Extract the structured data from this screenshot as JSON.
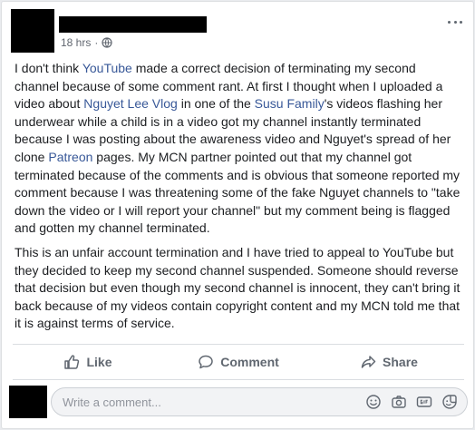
{
  "post": {
    "timestamp": "18 hrs",
    "separator": "·",
    "paragraph1": [
      {
        "text": "I don't think "
      },
      {
        "text": "YouTube",
        "link": true
      },
      {
        "text": " made a correct decision of terminating my second channel because of some comment rant. At first I thought when I uploaded a video about "
      },
      {
        "text": "Nguyet Lee Vlog",
        "link": true
      },
      {
        "text": " in one of the "
      },
      {
        "text": "Susu Family",
        "link": true
      },
      {
        "text": "'s videos flashing her underwear while a child is in a video got my channel instantly terminated because I was posting about the awareness video and Nguyet's spread of her clone "
      },
      {
        "text": "Patreon",
        "link": true
      },
      {
        "text": " pages. My MCN partner pointed out that my channel got terminated because of the comments and is obvious that someone reported my comment because I was threatening some of the fake Nguyet channels to \"take down the video or I will report your channel\" but my comment being is flagged and gotten my channel terminated."
      }
    ],
    "paragraph2": "This is an unfair account termination and I have tried to appeal to YouTube but they decided to keep my second channel suspended. Someone should reverse that decision but even though my second channel is innocent, they can't bring it back because of my videos contain copyright content and my MCN told me that it is against terms of service."
  },
  "actions": {
    "like_label": "Like",
    "comment_label": "Comment",
    "share_label": "Share"
  },
  "composer": {
    "placeholder": "Write a comment..."
  },
  "icons": {
    "privacy": "globe-icon",
    "more": "more-options-icon",
    "like": "thumbs-up-icon",
    "comment": "speech-bubble-icon",
    "share": "share-arrow-icon",
    "emoji": "smiley-icon",
    "camera": "camera-icon",
    "gif": "gif-icon",
    "sticker": "sticker-icon"
  },
  "colors": {
    "link": "#385898",
    "secondary_text": "#616770",
    "card_border": "#dddfe2",
    "page_background": "#e9ebee"
  }
}
